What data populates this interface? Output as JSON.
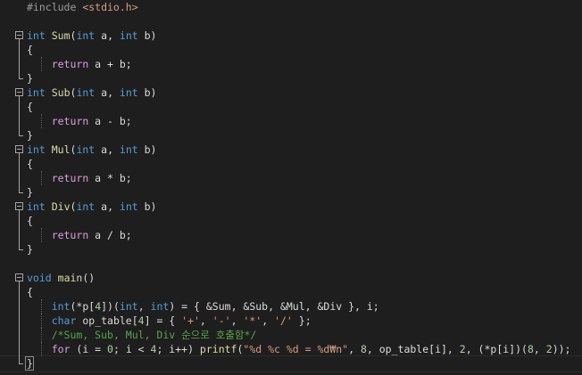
{
  "editor": {
    "lines": [
      {
        "segments": [
          {
            "t": "#include ",
            "c": "pp"
          },
          {
            "t": "<stdio.h>",
            "c": "inc"
          }
        ]
      },
      {
        "segments": []
      },
      {
        "fold": "open",
        "segments": [
          {
            "t": "int",
            "c": "kw"
          },
          {
            "t": " ",
            "c": "plain"
          },
          {
            "t": "Sum",
            "c": "fn"
          },
          {
            "t": "(",
            "c": "plain"
          },
          {
            "t": "int",
            "c": "kw"
          },
          {
            "t": " a, ",
            "c": "plain"
          },
          {
            "t": "int",
            "c": "kw"
          },
          {
            "t": " b)",
            "c": "plain"
          }
        ]
      },
      {
        "fold": "line",
        "segments": [
          {
            "t": "{",
            "c": "plain"
          }
        ]
      },
      {
        "fold": "line",
        "guide": true,
        "segments": [
          {
            "t": "    ",
            "c": "plain"
          },
          {
            "t": "return",
            "c": "ctl"
          },
          {
            "t": " a + b;",
            "c": "plain"
          }
        ]
      },
      {
        "fold": "end",
        "segments": [
          {
            "t": "}",
            "c": "plain"
          }
        ]
      },
      {
        "fold": "open",
        "segments": [
          {
            "t": "int",
            "c": "kw"
          },
          {
            "t": " ",
            "c": "plain"
          },
          {
            "t": "Sub",
            "c": "fn"
          },
          {
            "t": "(",
            "c": "plain"
          },
          {
            "t": "int",
            "c": "kw"
          },
          {
            "t": " a, ",
            "c": "plain"
          },
          {
            "t": "int",
            "c": "kw"
          },
          {
            "t": " b)",
            "c": "plain"
          }
        ]
      },
      {
        "fold": "line",
        "segments": [
          {
            "t": "{",
            "c": "plain"
          }
        ]
      },
      {
        "fold": "line",
        "guide": true,
        "segments": [
          {
            "t": "    ",
            "c": "plain"
          },
          {
            "t": "return",
            "c": "ctl"
          },
          {
            "t": " a - b;",
            "c": "plain"
          }
        ]
      },
      {
        "fold": "end",
        "segments": [
          {
            "t": "}",
            "c": "plain"
          }
        ]
      },
      {
        "fold": "open",
        "segments": [
          {
            "t": "int",
            "c": "kw"
          },
          {
            "t": " ",
            "c": "plain"
          },
          {
            "t": "Mul",
            "c": "fn"
          },
          {
            "t": "(",
            "c": "plain"
          },
          {
            "t": "int",
            "c": "kw"
          },
          {
            "t": " a, ",
            "c": "plain"
          },
          {
            "t": "int",
            "c": "kw"
          },
          {
            "t": " b)",
            "c": "plain"
          }
        ]
      },
      {
        "fold": "line",
        "segments": [
          {
            "t": "{",
            "c": "plain"
          }
        ]
      },
      {
        "fold": "line",
        "guide": true,
        "segments": [
          {
            "t": "    ",
            "c": "plain"
          },
          {
            "t": "return",
            "c": "ctl"
          },
          {
            "t": " a * b;",
            "c": "plain"
          }
        ]
      },
      {
        "fold": "end",
        "segments": [
          {
            "t": "}",
            "c": "plain"
          }
        ]
      },
      {
        "fold": "open",
        "segments": [
          {
            "t": "int",
            "c": "kw"
          },
          {
            "t": " ",
            "c": "plain"
          },
          {
            "t": "Div",
            "c": "fn"
          },
          {
            "t": "(",
            "c": "plain"
          },
          {
            "t": "int",
            "c": "kw"
          },
          {
            "t": " a, ",
            "c": "plain"
          },
          {
            "t": "int",
            "c": "kw"
          },
          {
            "t": " b)",
            "c": "plain"
          }
        ]
      },
      {
        "fold": "line",
        "segments": [
          {
            "t": "{",
            "c": "plain"
          }
        ]
      },
      {
        "fold": "line",
        "guide": true,
        "segments": [
          {
            "t": "    ",
            "c": "plain"
          },
          {
            "t": "return",
            "c": "ctl"
          },
          {
            "t": " a / b;",
            "c": "plain"
          }
        ]
      },
      {
        "fold": "end",
        "segments": [
          {
            "t": "}",
            "c": "plain"
          }
        ]
      },
      {
        "segments": []
      },
      {
        "fold": "open",
        "segments": [
          {
            "t": "void",
            "c": "kw"
          },
          {
            "t": " ",
            "c": "plain"
          },
          {
            "t": "main",
            "c": "fn"
          },
          {
            "t": "()",
            "c": "plain"
          }
        ]
      },
      {
        "fold": "line",
        "segments": [
          {
            "t": "{",
            "c": "plain"
          }
        ]
      },
      {
        "fold": "line",
        "guide": true,
        "segments": [
          {
            "t": "    ",
            "c": "plain"
          },
          {
            "t": "int",
            "c": "kw"
          },
          {
            "t": "(*p[",
            "c": "plain"
          },
          {
            "t": "4",
            "c": "num"
          },
          {
            "t": "])(",
            "c": "plain"
          },
          {
            "t": "int",
            "c": "kw"
          },
          {
            "t": ", ",
            "c": "plain"
          },
          {
            "t": "int",
            "c": "kw"
          },
          {
            "t": ") = { &Sum, &Sub, &Mul, &Div }, i;",
            "c": "plain"
          }
        ]
      },
      {
        "fold": "line",
        "guide": true,
        "segments": [
          {
            "t": "    ",
            "c": "plain"
          },
          {
            "t": "char",
            "c": "kw"
          },
          {
            "t": " op_table[",
            "c": "plain"
          },
          {
            "t": "4",
            "c": "num"
          },
          {
            "t": "] = { ",
            "c": "plain"
          },
          {
            "t": "'+'",
            "c": "str"
          },
          {
            "t": ", ",
            "c": "plain"
          },
          {
            "t": "'-'",
            "c": "str"
          },
          {
            "t": ", ",
            "c": "plain"
          },
          {
            "t": "'*'",
            "c": "str"
          },
          {
            "t": ", ",
            "c": "plain"
          },
          {
            "t": "'/'",
            "c": "str"
          },
          {
            "t": " };",
            "c": "plain"
          }
        ]
      },
      {
        "fold": "line",
        "guide": true,
        "segments": [
          {
            "t": "    ",
            "c": "plain"
          },
          {
            "t": "/*Sum, Sub, Mul, Div 순으로 호출함*/",
            "c": "com"
          }
        ]
      },
      {
        "fold": "line",
        "guide": true,
        "segments": [
          {
            "t": "    ",
            "c": "plain"
          },
          {
            "t": "for",
            "c": "ctl"
          },
          {
            "t": " (i = ",
            "c": "plain"
          },
          {
            "t": "0",
            "c": "num"
          },
          {
            "t": "; i < ",
            "c": "plain"
          },
          {
            "t": "4",
            "c": "num"
          },
          {
            "t": "; i++) ",
            "c": "plain"
          },
          {
            "t": "printf",
            "c": "fn"
          },
          {
            "t": "(",
            "c": "plain"
          },
          {
            "t": "\"%d %c %d = %d₩n\"",
            "c": "str"
          },
          {
            "t": ", ",
            "c": "plain"
          },
          {
            "t": "8",
            "c": "num"
          },
          {
            "t": ", op_table[i], ",
            "c": "plain"
          },
          {
            "t": "2",
            "c": "num"
          },
          {
            "t": ", (*p[i])(",
            "c": "plain"
          },
          {
            "t": "8",
            "c": "num"
          },
          {
            "t": ", ",
            "c": "plain"
          },
          {
            "t": "2",
            "c": "num"
          },
          {
            "t": "));",
            "c": "plain"
          }
        ]
      },
      {
        "fold": "end",
        "current": true,
        "segments": [
          {
            "t": "}",
            "c": "plain"
          }
        ]
      }
    ]
  }
}
